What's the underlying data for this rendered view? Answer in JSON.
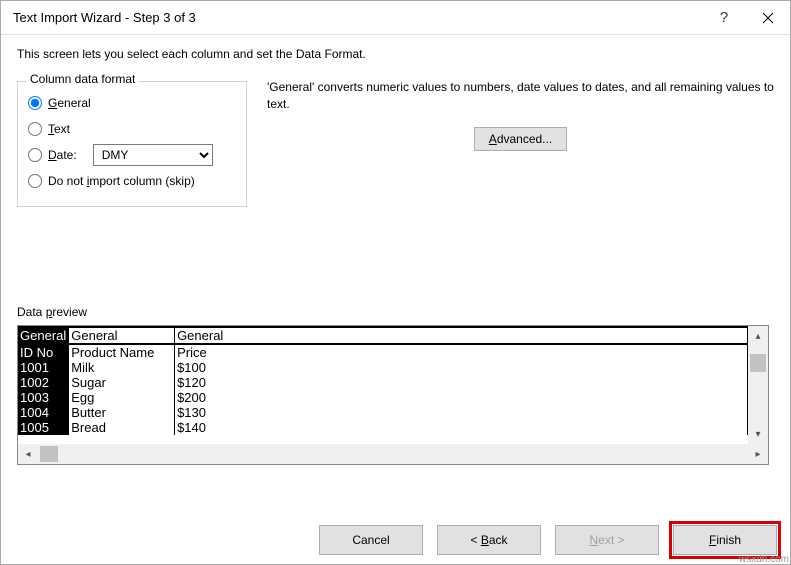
{
  "titlebar": {
    "title": "Text Import Wizard - Step 3 of 3"
  },
  "intro": "This screen lets you select each column and set the Data Format.",
  "fieldset": {
    "legend": "Column data format",
    "general": "General",
    "text": "Text",
    "date": "Date:",
    "date_value": "DMY",
    "skip": "Do not import column (skip)"
  },
  "hint": "'General' converts numeric values to numbers, date values to dates, and all remaining values to text.",
  "advanced": "Advanced...",
  "preview_label": "Data preview",
  "headers": [
    "General",
    "General",
    "General"
  ],
  "rows": [
    [
      "ID No",
      "Product Name",
      "Price"
    ],
    [
      "1001",
      "Milk",
      "$100"
    ],
    [
      "1002",
      "Sugar",
      "$120"
    ],
    [
      "1003",
      "Egg",
      "$200"
    ],
    [
      "1004",
      "Butter",
      "$130"
    ],
    [
      "1005",
      "Bread",
      "$140"
    ]
  ],
  "buttons": {
    "cancel": "Cancel",
    "back": "<  Back",
    "next": "Next  >",
    "finish": "Finish"
  },
  "watermark": "wsxdn.com"
}
